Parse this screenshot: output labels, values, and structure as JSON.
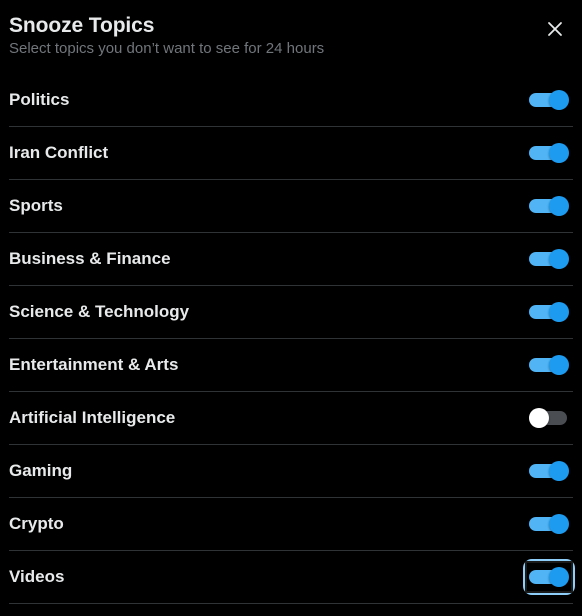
{
  "dialog": {
    "title": "Snooze Topics",
    "subtitle": "Select topics you don’t want to see for 24 hours",
    "close_icon": "close-icon"
  },
  "colors": {
    "background": "#000000",
    "text_primary": "#e7e9ea",
    "text_secondary": "#71767b",
    "divider": "#2f3336",
    "toggle_on_track": "#50b4f5",
    "toggle_on_knob": "#1d9bf0",
    "toggle_off_track": "#4a4e52",
    "toggle_off_knob": "#ffffff"
  },
  "topics": [
    {
      "label": "Politics",
      "enabled": true
    },
    {
      "label": "Iran Conflict",
      "enabled": true
    },
    {
      "label": "Sports",
      "enabled": true
    },
    {
      "label": "Business & Finance",
      "enabled": true
    },
    {
      "label": "Science & Technology",
      "enabled": true
    },
    {
      "label": "Entertainment & Arts",
      "enabled": true
    },
    {
      "label": "Artificial Intelligence",
      "enabled": false
    },
    {
      "label": "Gaming",
      "enabled": true
    },
    {
      "label": "Crypto",
      "enabled": true
    },
    {
      "label": "Videos",
      "enabled": true,
      "focused": true
    }
  ]
}
